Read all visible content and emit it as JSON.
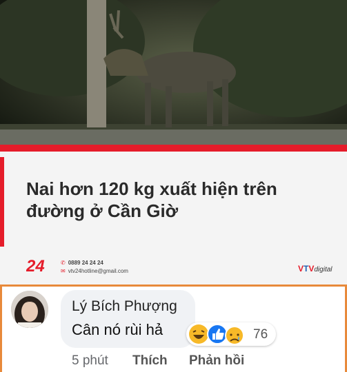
{
  "article": {
    "headline": "Nai hơn 120 kg xuất hiện trên đường ở Cần Giờ",
    "brand": "24",
    "phone": "0889 24 24 24",
    "email": "vtv24hotline@gmail.com",
    "channel_part1": "V",
    "channel_part2": "T",
    "channel_part3": "V",
    "channel_suffix": "digital"
  },
  "comment": {
    "author": "Lý Bích Phượng",
    "text": "Cân nó rùi hả",
    "reaction_count": "76",
    "reactions": [
      "haha-icon",
      "like-icon",
      "sad-icon"
    ],
    "time": "5 phút",
    "like_label": "Thích",
    "reply_label": "Phản hồi"
  },
  "colors": {
    "accent_red": "#e51c2a",
    "highlight_border": "#e8893a"
  }
}
